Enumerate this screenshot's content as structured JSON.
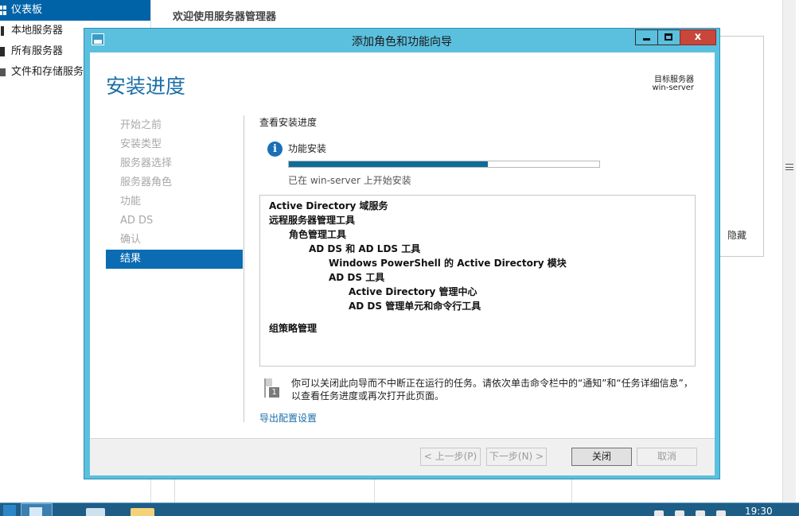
{
  "server_manager": {
    "nav": [
      {
        "label": "仪表板",
        "active": true
      },
      {
        "label": "本地服务器",
        "active": false
      },
      {
        "label": "所有服务器",
        "active": false
      },
      {
        "label": "文件和存储服务",
        "active": false
      }
    ],
    "main_title": "欢迎使用服务器管理器",
    "hide_label": "隐藏"
  },
  "taskbar": {
    "time": "19:30"
  },
  "wizard": {
    "title": "添加角色和功能向导",
    "heading": "安装进度",
    "destination": {
      "label": "目标服务器",
      "value": "win-server"
    },
    "steps": [
      {
        "label": "开始之前",
        "active": false
      },
      {
        "label": "安装类型",
        "active": false
      },
      {
        "label": "服务器选择",
        "active": false
      },
      {
        "label": "服务器角色",
        "active": false
      },
      {
        "label": "功能",
        "active": false
      },
      {
        "label": "AD DS",
        "active": false
      },
      {
        "label": "确认",
        "active": false
      },
      {
        "label": "结果",
        "active": true
      }
    ],
    "section_title": "查看安装进度",
    "feature_label": "功能安装",
    "progress_fraction": 0.64,
    "progress_status": "已在 win-server 上开始安装",
    "results": [
      {
        "label": "Active Directory 域服务",
        "level": 0
      },
      {
        "label": "远程服务器管理工具",
        "level": 0
      },
      {
        "label": "角色管理工具",
        "level": 1
      },
      {
        "label": "AD DS 和 AD LDS 工具",
        "level": 2
      },
      {
        "label": "Windows PowerShell 的 Active Directory 模块",
        "level": 3
      },
      {
        "label": "AD DS 工具",
        "level": 3
      },
      {
        "label": "Active Directory 管理中心",
        "level": 4
      },
      {
        "label": "AD DS 管理单元和命令行工具",
        "level": 4
      },
      {
        "label": "组策略管理",
        "level": 0,
        "gap": true
      }
    ],
    "note": "你可以关闭此向导而不中断正在运行的任务。请依次单击命令栏中的“通知”和“任务详细信息”，以查看任务进度或再次打开此页面。",
    "note_badge": "1",
    "export_link": "导出配置设置",
    "buttons": {
      "prev": "< 上一步(P)",
      "next": "下一步(N) >",
      "close": "关闭",
      "cancel": "取消"
    },
    "window_buttons": {
      "close": "x"
    }
  }
}
